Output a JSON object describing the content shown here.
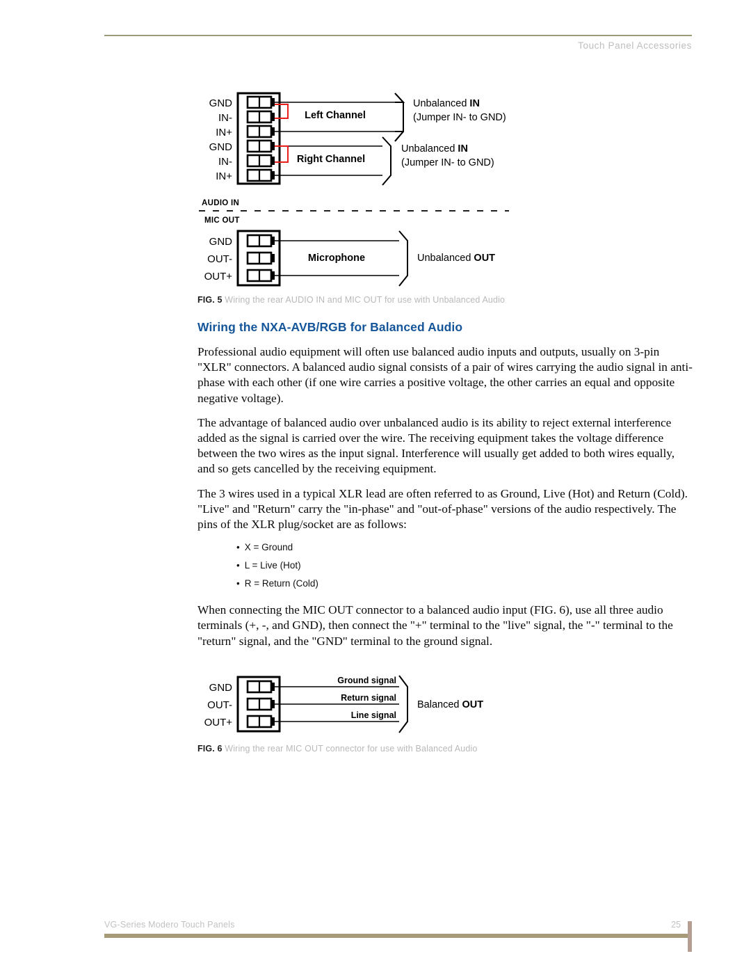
{
  "header": {
    "running_title": "Touch Panel Accessories"
  },
  "footer": {
    "doc_title": "VG-Series Modero Touch Panels",
    "page_number": "25"
  },
  "colors": {
    "heading_blue": "#15559a",
    "rule_olive": "#9a9a7a",
    "footer_bar": "#a79b77",
    "footer_tab": "#b59f93",
    "jumper_red": "#e8201c",
    "caption_gray": "#b9b9b9"
  },
  "figure5": {
    "audio_in_label": "AUDIO IN",
    "mic_out_label": "MIC OUT",
    "terminals_audio": [
      "GND",
      "IN-",
      "IN+",
      "GND",
      "IN-",
      "IN+"
    ],
    "terminals_mic": [
      "GND",
      "OUT-",
      "OUT+"
    ],
    "channel_left": "Left Channel",
    "channel_right": "Right Channel",
    "microphone": "Microphone",
    "bracket_left_line1_plain": "Unbalanced ",
    "bracket_left_line1_bold": "IN",
    "bracket_left_line2": "(Jumper IN- to GND)",
    "bracket_right_line1_plain": "Unbalanced ",
    "bracket_right_line1_bold": "IN",
    "bracket_right_line2": "(Jumper IN- to GND)",
    "mic_bracket_plain": "Unbalanced ",
    "mic_bracket_bold": "OUT",
    "caption_label": "FIG. 5",
    "caption_text": "Wiring the rear AUDIO IN and MIC OUT for use with Unbalanced Audio"
  },
  "section": {
    "heading": "Wiring the NXA-AVB/RGB for Balanced Audio",
    "paragraphs": [
      "Professional audio equipment will often use balanced audio inputs and outputs, usually on 3-pin \"XLR\" connectors. A balanced audio signal consists of a pair of wires carrying the audio signal in anti-phase with each other (if one wire carries a positive voltage, the other carries an equal and opposite negative voltage).",
      "The advantage of balanced audio over unbalanced audio is its ability to reject external interference added as the signal is carried over the wire. The receiving equipment takes the voltage difference between the two wires as the input signal. Interference will usually get added to both wires equally, and so gets cancelled by the receiving equipment.",
      "The 3 wires used in a typical XLR lead are often referred to as Ground, Live (Hot) and Return (Cold). \"Live\" and \"Return\" carry the \"in-phase\" and \"out-of-phase\" versions of the audio respectively. The pins of the XLR plug/socket are as follows:"
    ],
    "pin_list": [
      "X = Ground",
      "L = Live (Hot)",
      "R = Return (Cold)"
    ],
    "closing_paragraph": "When connecting the MIC OUT connector to a balanced audio input (FIG. 6), use all three audio terminals (+, -, and GND), then connect the \"+\" terminal to the \"live\" signal, the \"-\" terminal to the \"return\" signal, and the \"GND\" terminal to the ground signal."
  },
  "figure6": {
    "terminals": [
      "GND",
      "OUT-",
      "OUT+"
    ],
    "signal_labels": [
      "Ground signal",
      "Return signal",
      "Line signal"
    ],
    "bracket_plain": "Balanced ",
    "bracket_bold": "OUT",
    "caption_label": "FIG. 6",
    "caption_text": "Wiring the rear MIC OUT connector for use with Balanced Audio"
  }
}
